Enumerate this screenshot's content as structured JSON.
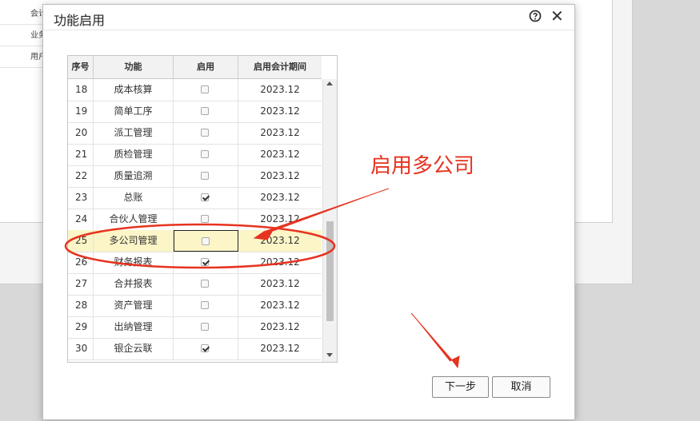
{
  "background": {
    "rows": [
      {
        "label": "会计"
      },
      {
        "label": "业务"
      },
      {
        "label": "用户"
      }
    ]
  },
  "dialog": {
    "title": "功能启用",
    "help_icon": "help-circle-icon",
    "close_icon": "close-icon",
    "close_glyph": "✕"
  },
  "table": {
    "headers": {
      "seq": "序号",
      "function": "功能",
      "enabled": "启用",
      "period": "启用会计期间"
    },
    "rows": [
      {
        "seq": "18",
        "function": "成本核算",
        "enabled": false,
        "period": "2023.12"
      },
      {
        "seq": "19",
        "function": "简单工序",
        "enabled": false,
        "period": "2023.12"
      },
      {
        "seq": "20",
        "function": "派工管理",
        "enabled": false,
        "period": "2023.12"
      },
      {
        "seq": "21",
        "function": "质检管理",
        "enabled": false,
        "period": "2023.12"
      },
      {
        "seq": "22",
        "function": "质量追溯",
        "enabled": false,
        "period": "2023.12"
      },
      {
        "seq": "23",
        "function": "总账",
        "enabled": true,
        "period": "2023.12"
      },
      {
        "seq": "24",
        "function": "合伙人管理",
        "enabled": false,
        "period": "2023.12"
      },
      {
        "seq": "25",
        "function": "多公司管理",
        "enabled": false,
        "period": "2023.12",
        "selected": true
      },
      {
        "seq": "26",
        "function": "财务报表",
        "enabled": true,
        "period": "2023.12"
      },
      {
        "seq": "27",
        "function": "合并报表",
        "enabled": false,
        "period": "2023.12"
      },
      {
        "seq": "28",
        "function": "资产管理",
        "enabled": false,
        "period": "2023.12"
      },
      {
        "seq": "29",
        "function": "出纳管理",
        "enabled": false,
        "period": "2023.12"
      },
      {
        "seq": "30",
        "function": "银企云联",
        "enabled": true,
        "period": "2023.12"
      }
    ]
  },
  "buttons": {
    "next": "下一步",
    "cancel": "取消"
  },
  "annotation": {
    "text": "启用多公司",
    "color": "#e63320"
  },
  "colors": {
    "selected_row": "#fbf5c8",
    "accent_red": "#e63320"
  }
}
